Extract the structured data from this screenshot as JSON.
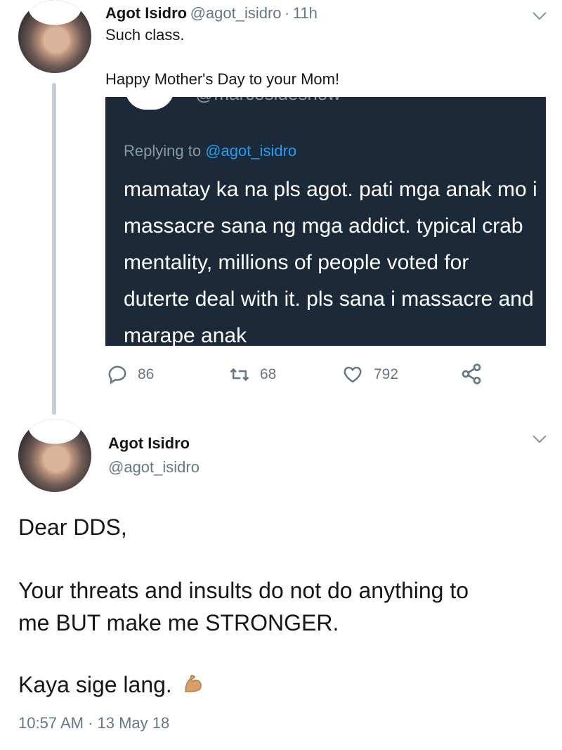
{
  "tweet1": {
    "name": "Agot Isidro",
    "handle": "@agot_isidro",
    "separator": "·",
    "time": "11h",
    "line1": "Such class.",
    "line2": "Happy Mother's Day to your Mom!"
  },
  "quoted": {
    "cropped_handle": "@marcosideshow",
    "replying_prefix": "Replying to ",
    "replying_handle": "@agot_isidro",
    "body": "mamatay ka na pls agot. pati mga anak mo i massacre sana ng mga addict. typical crab mentality, millions of people voted for duterte deal with it. pls sana i massacre and marape anak"
  },
  "actions": {
    "replies": "86",
    "retweets": "68",
    "likes": "792"
  },
  "tweet2": {
    "name": "Agot Isidro",
    "handle": "@agot_isidro",
    "line1": "Dear DDS,",
    "line2": "Your threats and insults do not do anything to",
    "line3": "me BUT make me STRONGER.",
    "line4": "Kaya sige lang.",
    "emoji": "flexed-biceps-icon",
    "timestamp": "10:57 AM · 13 May 18"
  },
  "colors": {
    "card_bg": "#1c2938",
    "link": "#1da1f2",
    "muted": "#657786",
    "text": "#14171a"
  }
}
